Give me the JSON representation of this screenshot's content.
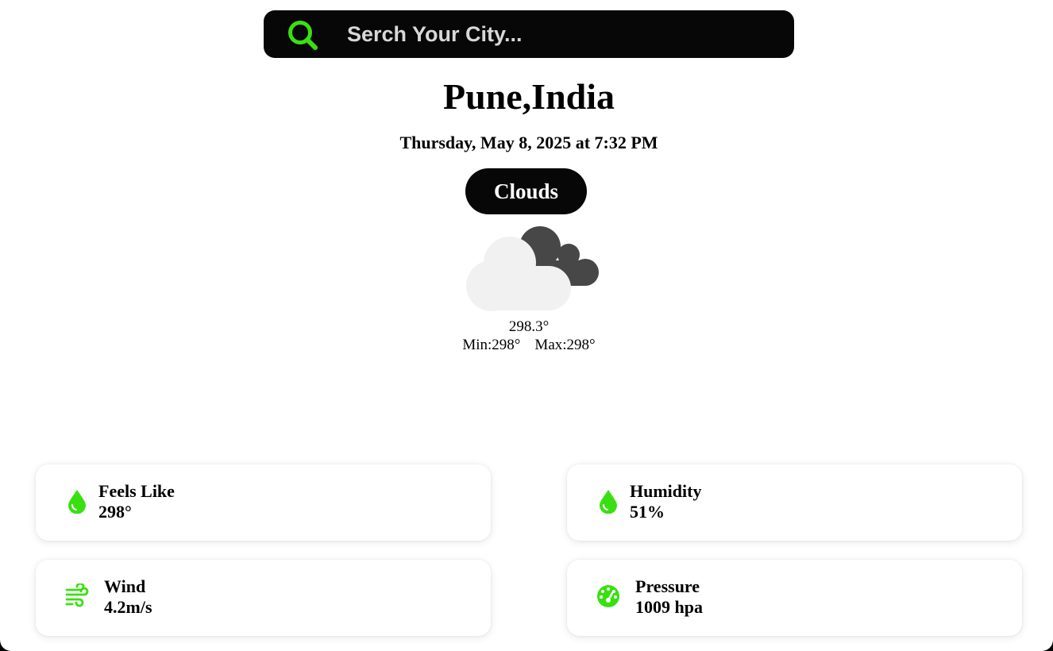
{
  "search": {
    "placeholder": "Serch Your City...",
    "icon": "search-icon",
    "icon_color": "#39e011"
  },
  "location": {
    "city": "Pune,India",
    "datetime": "Thursday, May 8, 2025 at 7:32 PM"
  },
  "weather": {
    "condition": "Clouds",
    "icon": "clouds-icon",
    "temperature": "298.3°",
    "min": "Min:298°",
    "max": "Max:298°"
  },
  "accent_color": "#39e011",
  "cards": [
    {
      "icon": "droplet-icon",
      "label": "Feels Like",
      "value": "298°"
    },
    {
      "icon": "droplet-icon",
      "label": "Humidity",
      "value": "51%"
    },
    {
      "icon": "wind-icon",
      "label": "Wind",
      "value": "4.2m/s"
    },
    {
      "icon": "gauge-icon",
      "label": "Pressure",
      "value": "1009 hpa"
    }
  ]
}
